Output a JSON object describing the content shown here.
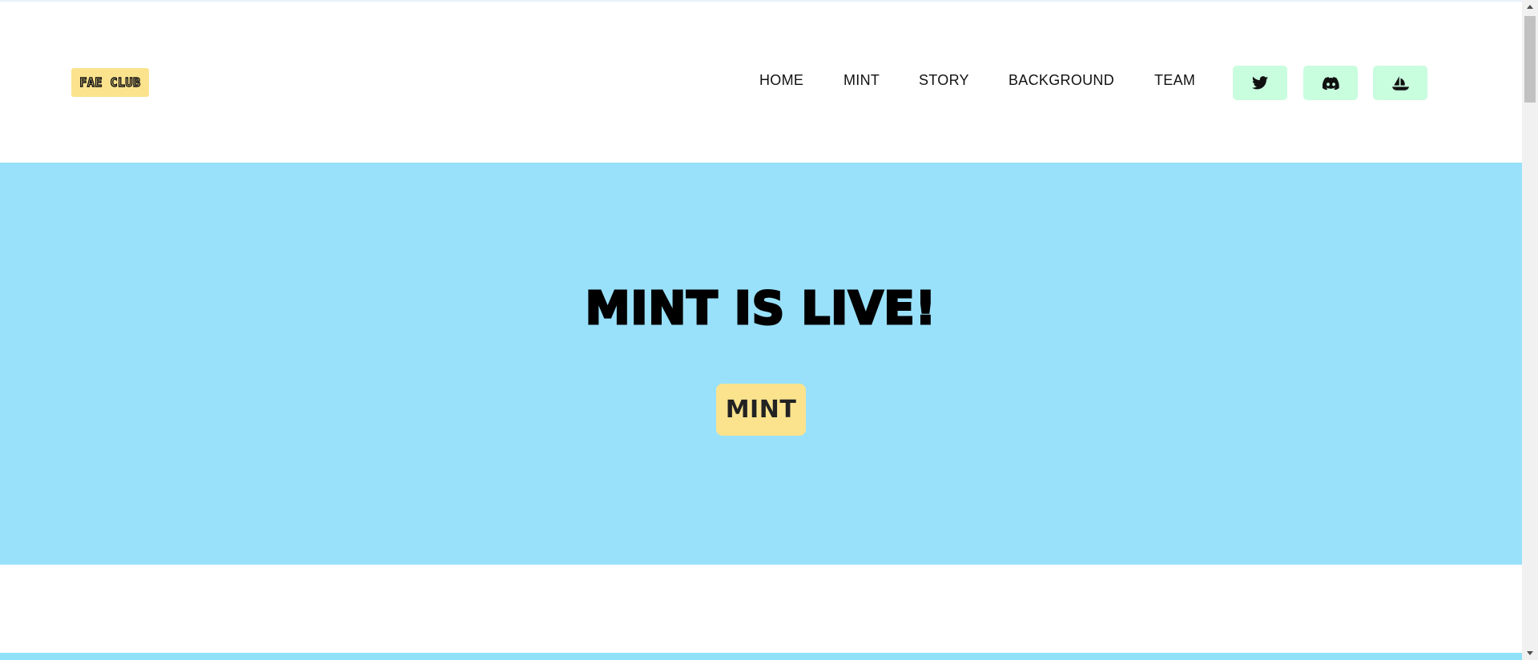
{
  "header": {
    "logo_text": "FAE CLUB",
    "nav": {
      "home": "HOME",
      "mint": "MINT",
      "story": "STORY",
      "background": "BACKGROUND",
      "team": "TEAM"
    },
    "social": [
      {
        "icon": "twitter-icon"
      },
      {
        "icon": "discord-icon"
      },
      {
        "icon": "opensea-icon"
      }
    ]
  },
  "hero": {
    "title": "MINT IS LIVE!",
    "mint_button": "MINT"
  },
  "colors": {
    "hero_bg": "#99e1fa",
    "accent_yellow": "#fbe38e",
    "social_bg": "#c8fdde"
  }
}
